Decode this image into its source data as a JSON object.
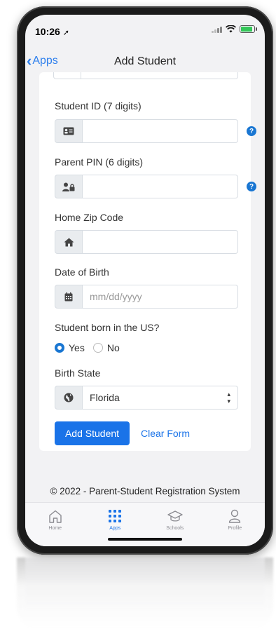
{
  "status_bar": {
    "time": "10:26"
  },
  "nav": {
    "back_label": "Apps",
    "title": "Add Student"
  },
  "form": {
    "student_id": {
      "label": "Student ID (7 digits)",
      "value": "",
      "help": "?"
    },
    "parent_pin": {
      "label": "Parent PIN (6 digits)",
      "value": "",
      "help": "?"
    },
    "zip": {
      "label": "Home Zip Code",
      "value": ""
    },
    "dob": {
      "label": "Date of Birth",
      "placeholder": "mm/dd/yyyy"
    },
    "born_us": {
      "label": "Student born in the US?",
      "options": [
        "Yes",
        "No"
      ],
      "selected": "Yes"
    },
    "birth_state": {
      "label": "Birth State",
      "value": "Florida"
    },
    "submit_label": "Add Student",
    "clear_label": "Clear Form"
  },
  "footer": {
    "text": "© 2022 - Parent-Student Registration System"
  },
  "tabs": [
    {
      "label": "Home",
      "icon": "home-icon"
    },
    {
      "label": "Apps",
      "icon": "apps-grid-icon",
      "active": true
    },
    {
      "label": "Schools",
      "icon": "graduation-cap-icon"
    },
    {
      "label": "Profile",
      "icon": "person-icon"
    }
  ],
  "colors": {
    "accent": "#1a73e8",
    "battery": "#34c759"
  }
}
